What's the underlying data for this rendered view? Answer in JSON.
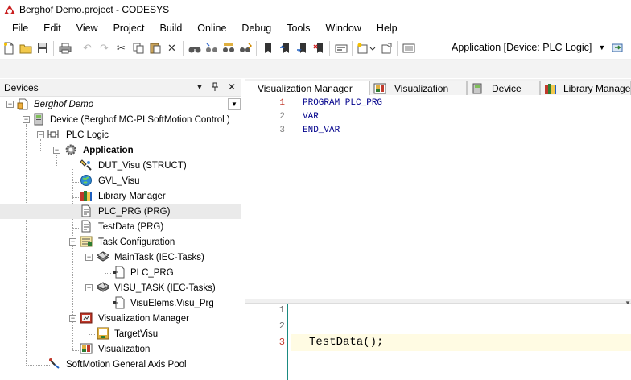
{
  "window": {
    "title": "Berghof Demo.project - CODESYS"
  },
  "menu": {
    "items": [
      "File",
      "Edit",
      "View",
      "Project",
      "Build",
      "Online",
      "Debug",
      "Tools",
      "Window",
      "Help"
    ]
  },
  "toolbar": {
    "active_application": "Application [Device: PLC Logic]",
    "buttons": [
      {
        "icon": "new-project-icon",
        "enabled": true
      },
      {
        "icon": "open-folder-icon",
        "enabled": true
      },
      {
        "icon": "save-icon",
        "enabled": true
      },
      {
        "icon": "print-icon",
        "enabled": true
      },
      {
        "icon": "undo-icon",
        "enabled": false
      },
      {
        "icon": "redo-icon",
        "enabled": false
      },
      {
        "icon": "cut-icon",
        "enabled": true
      },
      {
        "icon": "copy-icon",
        "enabled": true
      },
      {
        "icon": "paste-icon",
        "enabled": true
      },
      {
        "icon": "delete-icon",
        "enabled": true
      },
      {
        "icon": "find-icon",
        "enabled": true
      },
      {
        "icon": "find-next-icon",
        "enabled": true
      },
      {
        "icon": "find-in-project-icon",
        "enabled": true
      },
      {
        "icon": "replace-icon",
        "enabled": true
      },
      {
        "icon": "bookmark-icon",
        "enabled": true
      },
      {
        "icon": "next-bookmark-icon",
        "enabled": true
      },
      {
        "icon": "prev-bookmark-icon",
        "enabled": true
      },
      {
        "icon": "clear-bookmarks-icon",
        "enabled": true
      },
      {
        "icon": "build-icon",
        "enabled": true
      },
      {
        "icon": "add-object-icon",
        "enabled": true
      },
      {
        "icon": "add-folder-icon",
        "enabled": true
      },
      {
        "icon": "device-config-icon",
        "enabled": true
      }
    ]
  },
  "devices_panel": {
    "title": "Devices",
    "controls": {
      "dropdown": "▼",
      "pin": "📌",
      "close": "✕"
    },
    "tree": [
      {
        "label": "Berghof Demo",
        "icon": "project-icon",
        "level": 0,
        "expanded": true,
        "italic": true,
        "bold": false,
        "selected": false
      },
      {
        "label": "Device (Berghof MC-PI SoftMotion Control )",
        "icon": "device-icon",
        "level": 1,
        "expanded": true,
        "italic": false,
        "bold": false,
        "selected": false
      },
      {
        "label": "PLC Logic",
        "icon": "plc-logic-icon",
        "level": 2,
        "expanded": true,
        "italic": false,
        "bold": false,
        "selected": false
      },
      {
        "label": "Application",
        "icon": "application-gear-icon",
        "level": 3,
        "expanded": true,
        "italic": false,
        "bold": true,
        "selected": false
      },
      {
        "label": "DUT_Visu (STRUCT)",
        "icon": "dut-icon",
        "level": 4,
        "expanded": null,
        "italic": false,
        "bold": false,
        "selected": false
      },
      {
        "label": "GVL_Visu",
        "icon": "gvl-globe-icon",
        "level": 4,
        "expanded": null,
        "italic": false,
        "bold": false,
        "selected": false
      },
      {
        "label": "Library Manager",
        "icon": "library-manager-icon",
        "level": 4,
        "expanded": null,
        "italic": false,
        "bold": false,
        "selected": false
      },
      {
        "label": "PLC_PRG (PRG)",
        "icon": "program-pou-icon",
        "level": 4,
        "expanded": null,
        "italic": false,
        "bold": false,
        "selected": true
      },
      {
        "label": "TestData (PRG)",
        "icon": "program-pou-icon",
        "level": 4,
        "expanded": null,
        "italic": false,
        "bold": false,
        "selected": false
      },
      {
        "label": "Task Configuration",
        "icon": "task-configuration-icon",
        "level": 4,
        "expanded": true,
        "italic": false,
        "bold": false,
        "selected": false
      },
      {
        "label": "MainTask (IEC-Tasks)",
        "icon": "task-icon",
        "level": 5,
        "expanded": true,
        "italic": false,
        "bold": false,
        "selected": false
      },
      {
        "label": "PLC_PRG",
        "icon": "program-call-icon",
        "level": 6,
        "expanded": null,
        "italic": false,
        "bold": false,
        "selected": false
      },
      {
        "label": "VISU_TASK (IEC-Tasks)",
        "icon": "task-icon",
        "level": 5,
        "expanded": true,
        "italic": false,
        "bold": false,
        "selected": false
      },
      {
        "label": "VisuElems.Visu_Prg",
        "icon": "program-call-icon",
        "level": 6,
        "expanded": null,
        "italic": false,
        "bold": false,
        "selected": false
      },
      {
        "label": "Visualization Manager",
        "icon": "visualization-manager-icon",
        "level": 4,
        "expanded": true,
        "italic": false,
        "bold": false,
        "selected": false
      },
      {
        "label": "TargetVisu",
        "icon": "target-visu-icon",
        "level": 5,
        "expanded": null,
        "italic": false,
        "bold": false,
        "selected": false
      },
      {
        "label": "Visualization",
        "icon": "visualization-icon",
        "level": 4,
        "expanded": null,
        "italic": false,
        "bold": false,
        "selected": false
      },
      {
        "label": "SoftMotion General Axis Pool",
        "icon": "axis-pool-icon",
        "level": 2,
        "expanded": null,
        "italic": false,
        "bold": false,
        "selected": false
      }
    ]
  },
  "editor": {
    "tabs": [
      {
        "label": "Visualization Manager",
        "icon": "",
        "active": false
      },
      {
        "label": "Visualization",
        "icon": "visualization-icon",
        "active": false
      },
      {
        "label": "Device",
        "icon": "device-icon",
        "active": false
      },
      {
        "label": "Library Manager",
        "icon": "library-manager-icon",
        "active": false
      }
    ],
    "declaration": {
      "line_numbers": [
        "1",
        "2",
        "3"
      ],
      "lines": [
        "PROGRAM PLC_PRG",
        "VAR",
        "END_VAR"
      ]
    },
    "implementation": {
      "line_numbers": [
        "1",
        "2",
        "3"
      ],
      "lines": [
        "",
        "",
        "TestData();"
      ]
    }
  },
  "colors": {
    "keyword_blue": "#00008b",
    "line_number_red": "#c0392b",
    "selection_grey": "#eaeaea",
    "current_line_yellow": "#fffbe3",
    "gutter_teal": "#1a8a80"
  }
}
